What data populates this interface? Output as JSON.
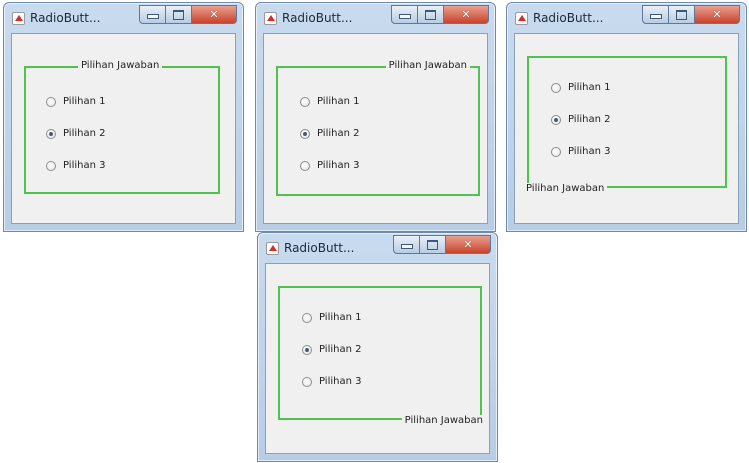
{
  "windows": [
    {
      "title": "RadioButt...",
      "legend": "Pilihan Jawaban",
      "options": [
        {
          "label": "Pilihan 1",
          "checked": false
        },
        {
          "label": "Pilihan 2",
          "checked": true
        },
        {
          "label": "Pilihan 3",
          "checked": false
        }
      ]
    },
    {
      "title": "RadioButt...",
      "legend": "Pilihan Jawaban",
      "options": [
        {
          "label": "Pilihan 1",
          "checked": false
        },
        {
          "label": "Pilihan 2",
          "checked": true
        },
        {
          "label": "Pilihan 3",
          "checked": false
        }
      ]
    },
    {
      "title": "RadioButt...",
      "legend": "Pilihan Jawaban",
      "options": [
        {
          "label": "Pilihan 1",
          "checked": false
        },
        {
          "label": "Pilihan 2",
          "checked": true
        },
        {
          "label": "Pilihan 3",
          "checked": false
        }
      ]
    },
    {
      "title": "RadioButt...",
      "legend": "Pilihan Jawaban",
      "options": [
        {
          "label": "Pilihan 1",
          "checked": false
        },
        {
          "label": "Pilihan 2",
          "checked": true
        },
        {
          "label": "Pilihan 3",
          "checked": false
        }
      ]
    }
  ],
  "icons": {
    "app": "java-app-icon",
    "minimize": "minimize-icon",
    "maximize": "maximize-icon",
    "close": "close-icon"
  },
  "colors": {
    "group_border": "#4fc24f",
    "close_button": "#c8432c",
    "window_frame": "#b7cde6",
    "client_background": "#f0f0f0"
  }
}
